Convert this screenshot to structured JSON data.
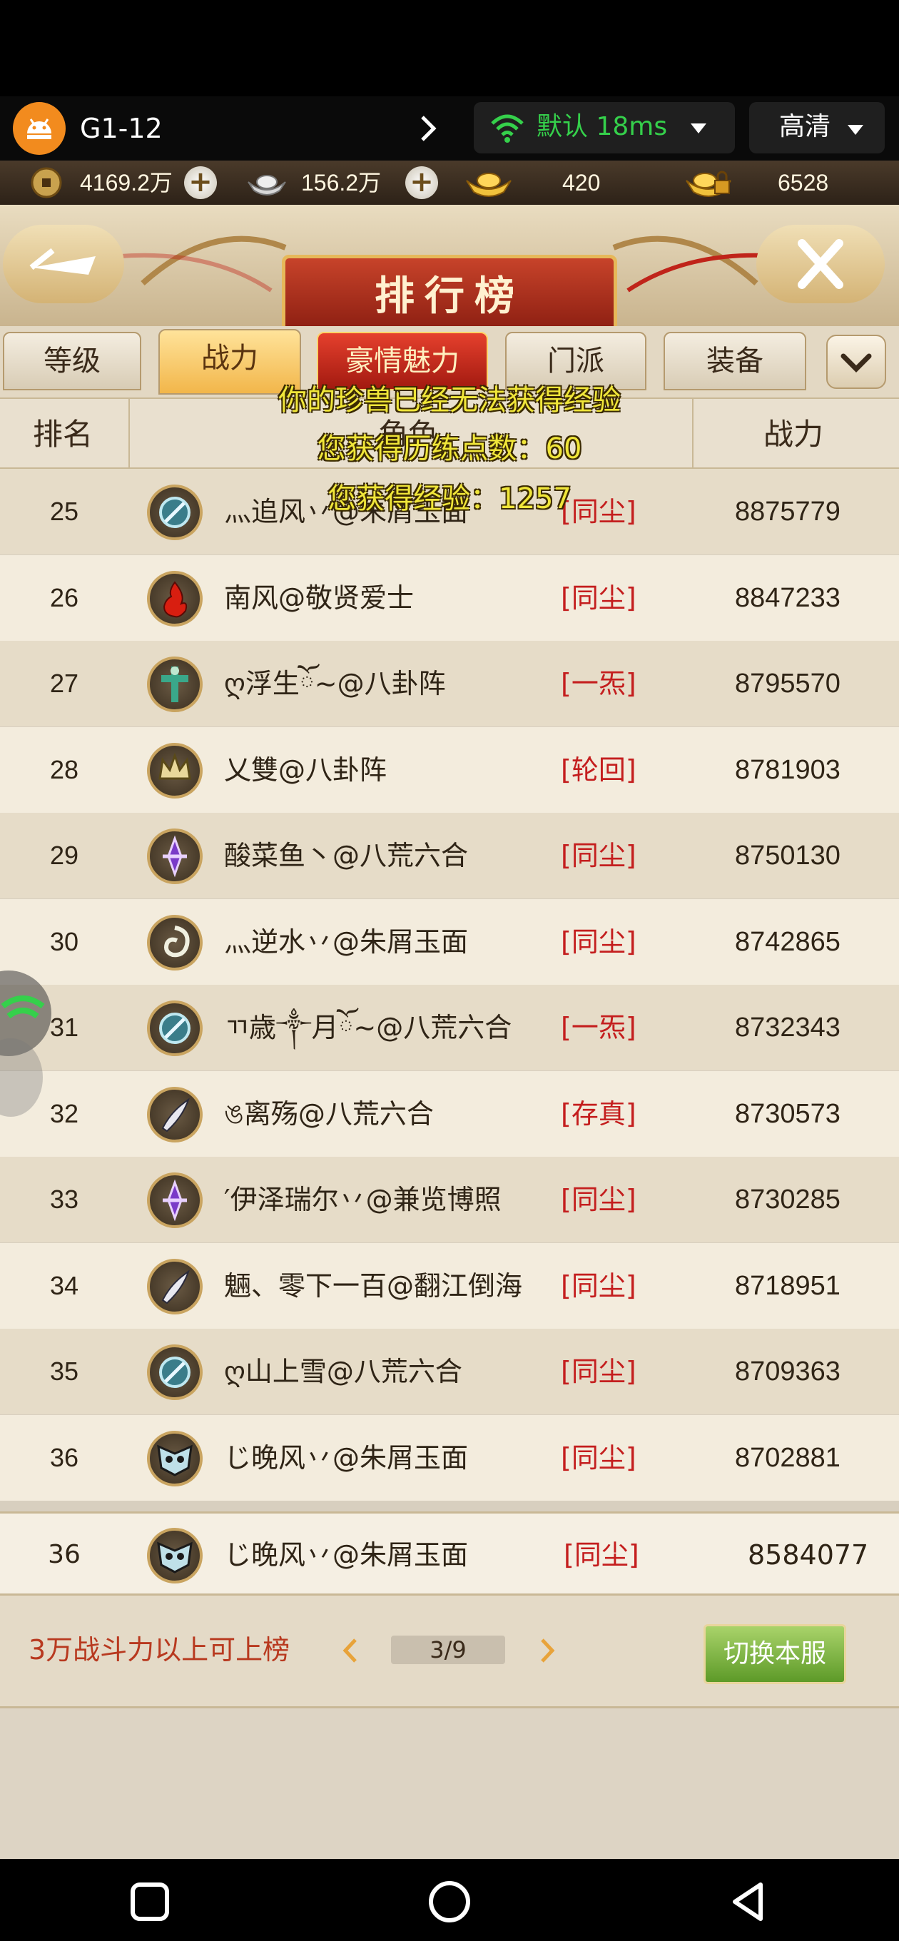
{
  "topbar": {
    "device_name": "G1-12",
    "network_label": "默认 18ms",
    "quality_label": "高清"
  },
  "currency": {
    "copper": "4169.2万",
    "silver": "156.2万",
    "gold": "420",
    "bound_gold": "6528"
  },
  "header": {
    "title": "排行榜"
  },
  "tabs": [
    {
      "label": "等级"
    },
    {
      "label": "战力"
    },
    {
      "label": "豪情魅力"
    },
    {
      "label": "门派"
    },
    {
      "label": "装备"
    }
  ],
  "columns": {
    "rank": "排名",
    "name": "角色",
    "power": "战力"
  },
  "rows": [
    {
      "rank": "25",
      "name": "灬追风丷@朱屑玉面",
      "sect": "[同尘]",
      "power": "8875779",
      "icon": "mirror-icon"
    },
    {
      "rank": "26",
      "name": "南风@敬贤爱士",
      "sect": "[同尘]",
      "power": "8847233",
      "icon": "flame-icon"
    },
    {
      "rank": "27",
      "name": "ღ浮生ོ~@八卦阵",
      "sect": "[一炁]",
      "power": "8795570",
      "icon": "totem-icon"
    },
    {
      "rank": "28",
      "name": "乂雙@八卦阵",
      "sect": "[轮回]",
      "power": "8781903",
      "icon": "crown-icon"
    },
    {
      "rank": "29",
      "name": "酸菜鱼丶@八荒六合",
      "sect": "[同尘]",
      "power": "8750130",
      "icon": "sword-icon"
    },
    {
      "rank": "30",
      "name": "灬逆水丷@朱屑玉面",
      "sect": "[同尘]",
      "power": "8742865",
      "icon": "swirl-icon"
    },
    {
      "rank": "31",
      "name": "ㄲ歳༒月ོ~@八荒六合",
      "sect": "[一炁]",
      "power": "8732343",
      "icon": "mirror-icon"
    },
    {
      "rank": "32",
      "name": "ঙ离殇@八荒六合",
      "sect": "[存真]",
      "power": "8730573",
      "icon": "blade-icon"
    },
    {
      "rank": "33",
      "name": "′伊泽瑞尔丷@兼览博照",
      "sect": "[同尘]",
      "power": "8730285",
      "icon": "sword-icon"
    },
    {
      "rank": "34",
      "name": "魎、零下一百@翻江倒海",
      "sect": "[同尘]",
      "power": "8718951",
      "icon": "blade-icon"
    },
    {
      "rank": "35",
      "name": "ღ山上雪@八荒六合",
      "sect": "[同尘]",
      "power": "8709363",
      "icon": "mirror-icon"
    },
    {
      "rank": "36",
      "name": "じ晚风丷@朱屑玉面",
      "sect": "[同尘]",
      "power": "8702881",
      "icon": "mask-icon"
    }
  ],
  "my_row": {
    "rank": "36",
    "name": "じ晚风丷@朱屑玉面",
    "sect": "[同尘]",
    "power": "8584077"
  },
  "footer": {
    "hint": "3万战斗力以上可上榜",
    "page": "3/9",
    "switch_label": "切换本服"
  },
  "floaters": {
    "line1": "你的珍兽已经无法获得经验",
    "line2": "您获得历练点数：60",
    "line3": "您获得经验：1257"
  },
  "colors": {
    "sect_red": "#c41e1e",
    "active_tab": "#f2b64a",
    "net_green": "#35d04b"
  }
}
